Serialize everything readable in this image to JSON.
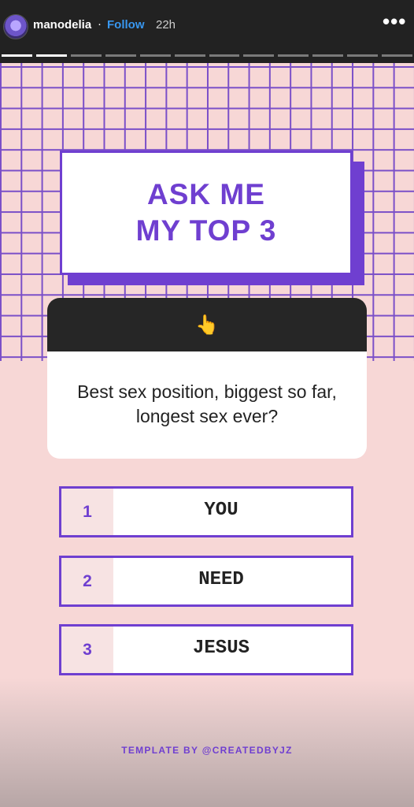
{
  "header": {
    "username": "manodelia",
    "separator": "·",
    "follow_label": "Follow",
    "timestamp": "22h",
    "more_label": "•••",
    "progress_segments": 12,
    "progress_completed": 2
  },
  "story": {
    "title_line1": "ASK ME",
    "title_line2": "MY TOP 3",
    "question_emoji": "👆",
    "question_icon": "pointing-finger-emoji",
    "question_text": "Best sex position, biggest so far, longest sex ever?",
    "answers": [
      {
        "number": "1",
        "label": "YOU"
      },
      {
        "number": "2",
        "label": "NEED"
      },
      {
        "number": "3",
        "label": "JESUS"
      }
    ],
    "credit": "TEMPLATE BY @CREATEDBYJZ"
  },
  "colors": {
    "accent_purple": "#6f3fd0",
    "background_pink": "#f7d7d6",
    "follow_blue": "#3897f0",
    "topbar": "#222222"
  }
}
